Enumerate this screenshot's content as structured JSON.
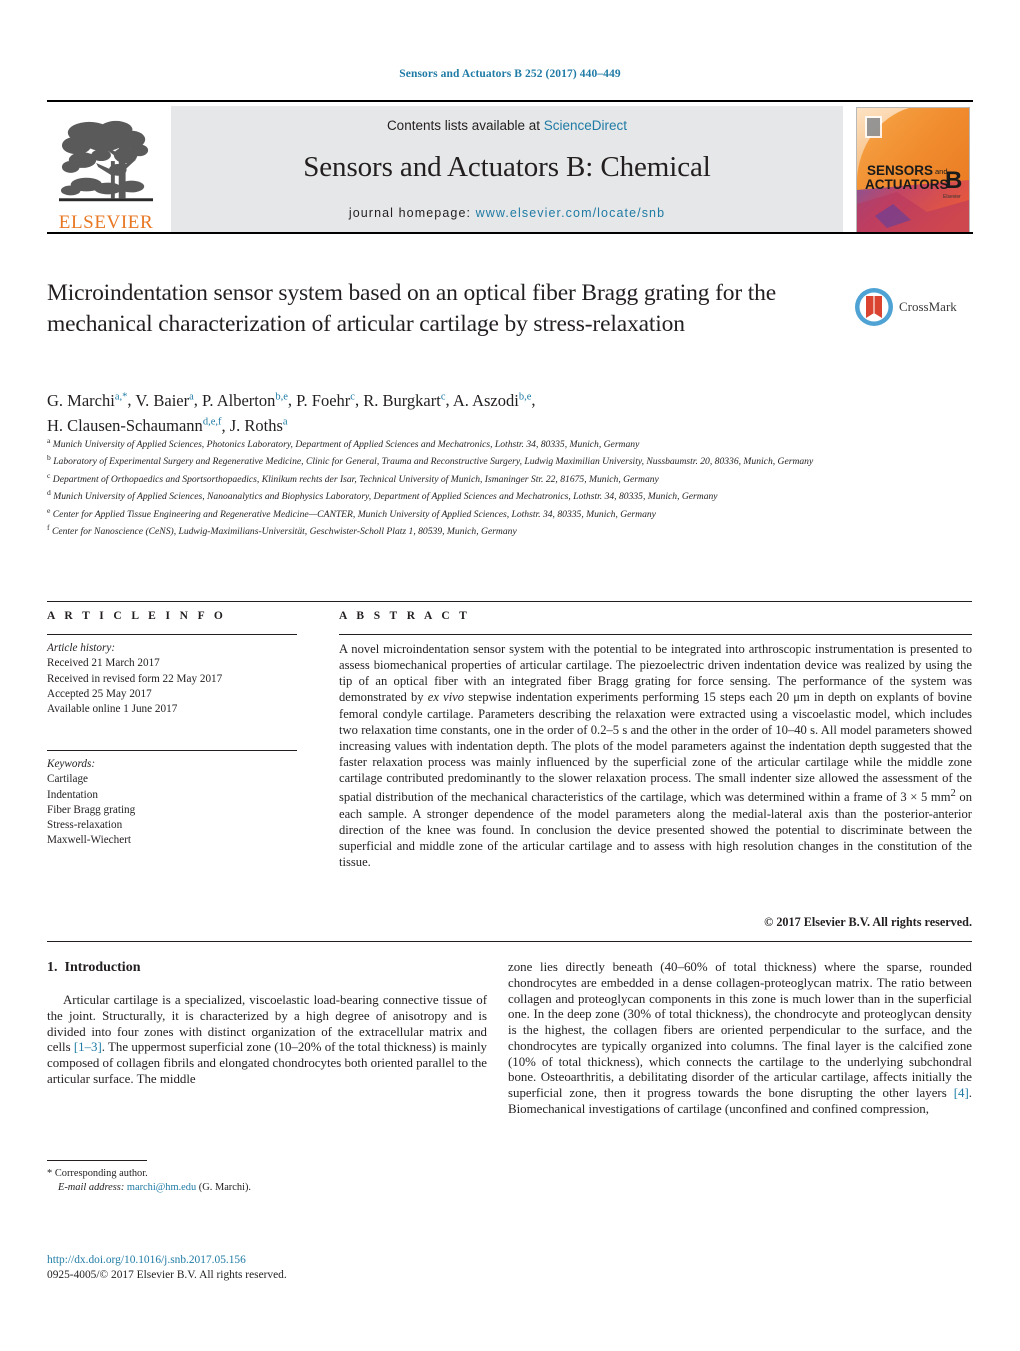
{
  "running_head": "Sensors and Actuators B 252 (2017) 440–449",
  "masthead": {
    "contents_prefix": "Contents lists available at ",
    "sciencedirect": "ScienceDirect",
    "journal_title": "Sensors and Actuators B: Chemical",
    "homepage_label": "journal homepage:",
    "homepage_url": "www.elsevier.com/locate/snb",
    "publisher": "ELSEVIER",
    "cover": {
      "line1": "SENSORS",
      "line1_and": "and",
      "line2": "ACTUATORS",
      "letter": "B",
      "imprint": "Elsevier"
    }
  },
  "article": {
    "title": "Microindentation sensor system based on an optical fiber Bragg grating for the mechanical characterization of articular cartilage by stress-relaxation",
    "crossmark_label": "CrossMark",
    "authors": [
      {
        "name": "G. Marchi",
        "sup": "a,*"
      },
      {
        "name": "V. Baier",
        "sup": "a"
      },
      {
        "name": "P. Alberton",
        "sup": "b,e"
      },
      {
        "name": "P. Foehr",
        "sup": "c"
      },
      {
        "name": "R. Burgkart",
        "sup": "c"
      },
      {
        "name": "A. Aszodi",
        "sup": "b,e"
      },
      {
        "name": "H. Clausen-Schaumann",
        "sup": "d,e,f"
      },
      {
        "name": "J. Roths",
        "sup": "a"
      }
    ],
    "affiliations": [
      {
        "mark": "a",
        "text": "Munich University of Applied Sciences, Photonics Laboratory, Department of Applied Sciences and Mechatronics, Lothstr. 34, 80335, Munich, Germany"
      },
      {
        "mark": "b",
        "text": "Laboratory of Experimental Surgery and Regenerative Medicine, Clinic for General, Trauma and Reconstructive Surgery, Ludwig Maximilian University, Nussbaumstr. 20, 80336, Munich, Germany"
      },
      {
        "mark": "c",
        "text": "Department of Orthopaedics and Sportsorthopaedics, Klinikum rechts der Isar, Technical University of Munich, Ismaninger Str. 22, 81675, Munich, Germany"
      },
      {
        "mark": "d",
        "text": "Munich University of Applied Sciences, Nanoanalytics and Biophysics Laboratory, Department of Applied Sciences and Mechatronics, Lothstr. 34, 80335, Munich, Germany"
      },
      {
        "mark": "e",
        "text": "Center for Applied Tissue Engineering and Regenerative Medicine—CANTER, Munich University of Applied Sciences, Lothstr. 34, 80335, Munich, Germany"
      },
      {
        "mark": "f",
        "text": "Center for Nanoscience (CeNS), Ludwig-Maximilians-Universität, Geschwister-Scholl Platz 1, 80539, Munich, Germany"
      }
    ]
  },
  "article_info": {
    "heading": "A R T I C L E   I N F O",
    "history_label": "Article history:",
    "history": [
      "Received 21 March 2017",
      "Received in revised form 22 May 2017",
      "Accepted 25 May 2017",
      "Available online 1 June 2017"
    ],
    "keywords_label": "Keywords:",
    "keywords": [
      "Cartilage",
      "Indentation",
      "Fiber Bragg grating",
      "Stress-relaxation",
      "Maxwell-Wiechert"
    ]
  },
  "abstract": {
    "heading": "A B S T R A C T",
    "part1": "A novel microindentation sensor system with the potential to be integrated into arthroscopic instrumentation is presented to assess biomechanical properties of articular cartilage. The piezoelectric driven indentation device was realized by using the tip of an optical fiber with an integrated fiber Bragg grating for force sensing. The performance of the system was demonstrated by ",
    "italic1": "ex vivo",
    "part2": " stepwise indentation experiments performing 15 steps each 20 μm in depth on explants of bovine femoral condyle cartilage. Parameters describing the relaxation were extracted using a viscoelastic model, which includes two relaxation time constants, one in the order of 0.2–5 s and the other in the order of 10–40 s. All model parameters showed increasing values with indentation depth. The plots of the model parameters against the indentation depth suggested that the faster relaxation process was mainly influenced by the superficial zone of the articular cartilage while the middle zone cartilage contributed predominantly to the slower relaxation process. The small indenter size allowed the assessment of the spatial distribution of the mechanical characteristics of the cartilage, which was determined within a frame of 3 × 5 mm",
    "sup": "2",
    "part3": " on each sample. A stronger dependence of the model parameters along the medial-lateral axis than the posterior-anterior direction of the knee was found. In conclusion the device presented showed the potential to discriminate between the superficial and middle zone of the articular cartilage and to assess with high resolution changes in the constitution of the tissue.",
    "copyright": "© 2017 Elsevier B.V. All rights reserved."
  },
  "body": {
    "section_number": "1.",
    "section_title": "Introduction",
    "left_part1": "Articular cartilage is a specialized, viscoelastic load-bearing connective tissue of the joint. Structurally, it is characterized by a high degree of anisotropy and is divided into four zones with distinct organization of the extracellular matrix and cells ",
    "ref1": "[1–3]",
    "left_part2": ". The uppermost superficial zone (10–20% of the total thickness) is mainly composed of collagen fibrils and elongated chondrocytes both oriented parallel to the articular surface. The middle",
    "right_part1": "zone lies directly beneath (40–60% of total thickness) where the sparse, rounded chondrocytes are embedded in a dense collagen-proteoglycan matrix. The ratio between collagen and proteoglycan components in this zone is much lower than in the superficial one. In the deep zone (30% of total thickness), the chondrocyte and proteoglycan density is the highest, the collagen fibers are oriented perpendicular to the surface, and the chondrocytes are typically organized into columns. The final layer is the calcified zone (10% of total thickness), which connects the cartilage to the underlying subchondral bone. Osteoarthritis, a debilitating disorder of the articular cartilage, affects initially the superficial zone, then it progress towards the bone disrupting the other layers ",
    "ref2": "[4]",
    "right_part2": ". Biomechanical investigations of cartilage (unconfined and confined compression,"
  },
  "footer": {
    "corresponding_mark": "*",
    "corresponding_label": "Corresponding author.",
    "email_label": "E-mail address:",
    "email": "marchi@hm.edu",
    "email_owner": "(G. Marchi).",
    "doi": "http://dx.doi.org/10.1016/j.snb.2017.05.156",
    "issn_line": "0925-4005/© 2017 Elsevier B.V. All rights reserved."
  },
  "colors": {
    "link": "#1f7ba5",
    "elsevier_orange": "#e87722",
    "band_gray": "#e6e7e8"
  }
}
